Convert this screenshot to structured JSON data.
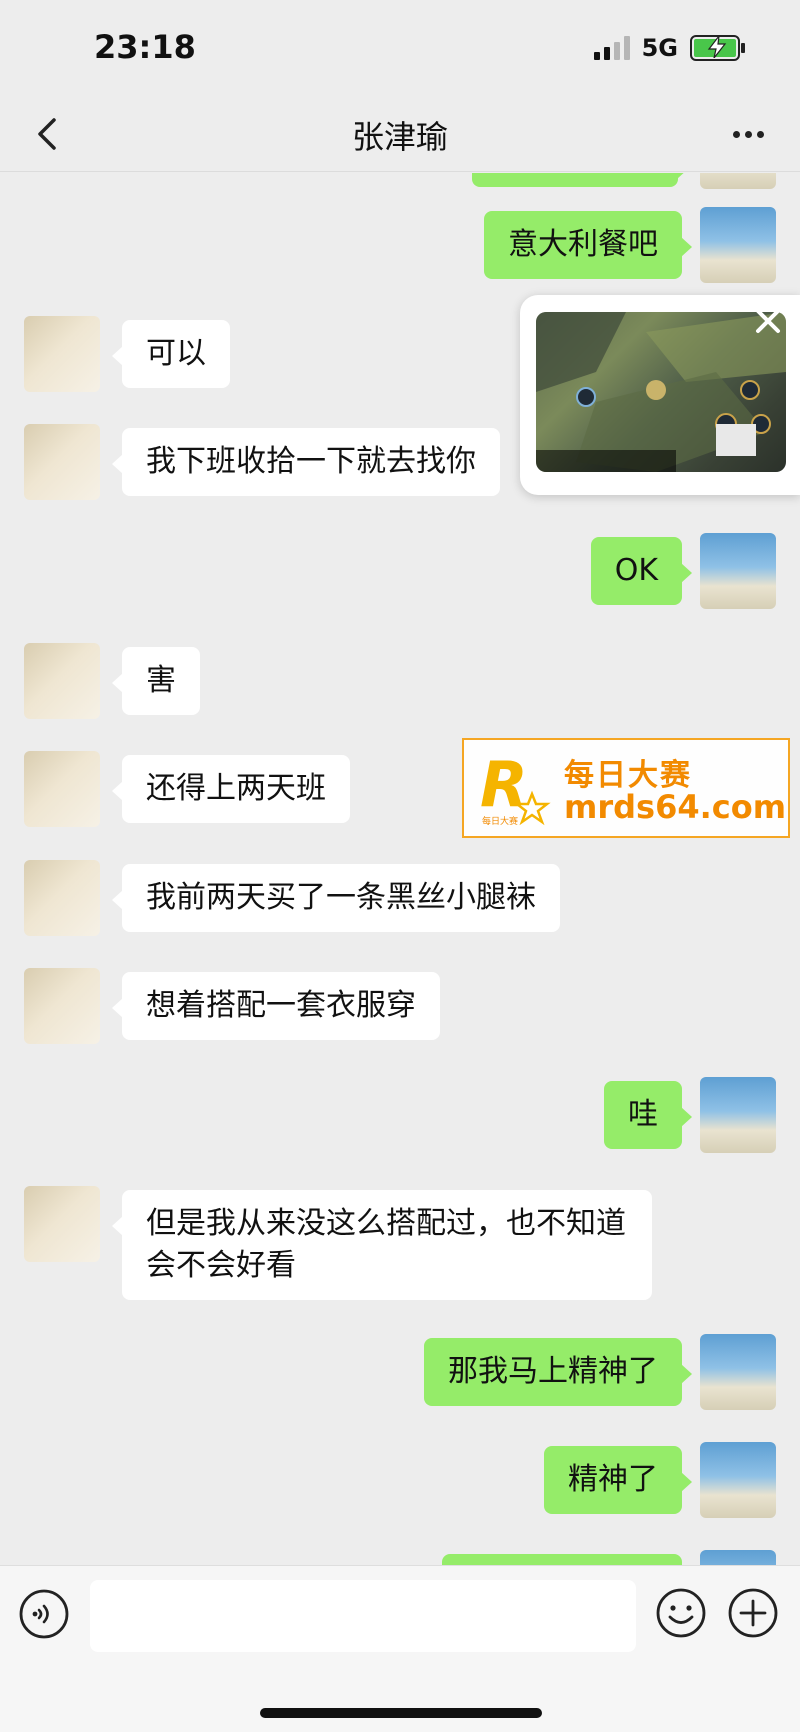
{
  "status_bar": {
    "time": "23:18",
    "network": "5G",
    "signal_bars": 4,
    "signal_bars_active": 2,
    "battery": "charging"
  },
  "nav": {
    "title": "张津瑜",
    "back_icon": "chevron-left-icon",
    "more_icon": "ellipsis-icon"
  },
  "messages": [
    {
      "side": "out",
      "text": "意大利餐吧"
    },
    {
      "side": "in",
      "text": "可以"
    },
    {
      "side": "in",
      "text": "我下班收拾一下就去找你"
    },
    {
      "side": "out",
      "text": "OK"
    },
    {
      "side": "in",
      "text": "害"
    },
    {
      "side": "in",
      "text": "还得上两天班"
    },
    {
      "side": "in",
      "text": "我前两天买了一条黑丝小腿袜"
    },
    {
      "side": "in",
      "text": "想着搭配一套衣服穿"
    },
    {
      "side": "out",
      "text": "哇"
    },
    {
      "side": "in",
      "text": "但是我从来没这么搭配过，也不知道会不会好看"
    },
    {
      "side": "out",
      "text": "那我马上精神了"
    },
    {
      "side": "out",
      "text": "精神了"
    }
  ],
  "floating_window": {
    "content": "game-screen",
    "close_icon": "close-icon"
  },
  "watermark": {
    "logo_text": "R",
    "logo_sub": "每日大赛",
    "cn_text": "每日大赛",
    "url_text": "mrds64.com"
  },
  "input_bar": {
    "input_value": "",
    "voice_icon": "voice-icon",
    "emoji_icon": "emoji-icon",
    "plus_icon": "plus-icon"
  },
  "colors": {
    "background": "#ededed",
    "incoming_bubble": "#ffffff",
    "outgoing_bubble": "#95ec69",
    "watermark": "#f28a00"
  }
}
